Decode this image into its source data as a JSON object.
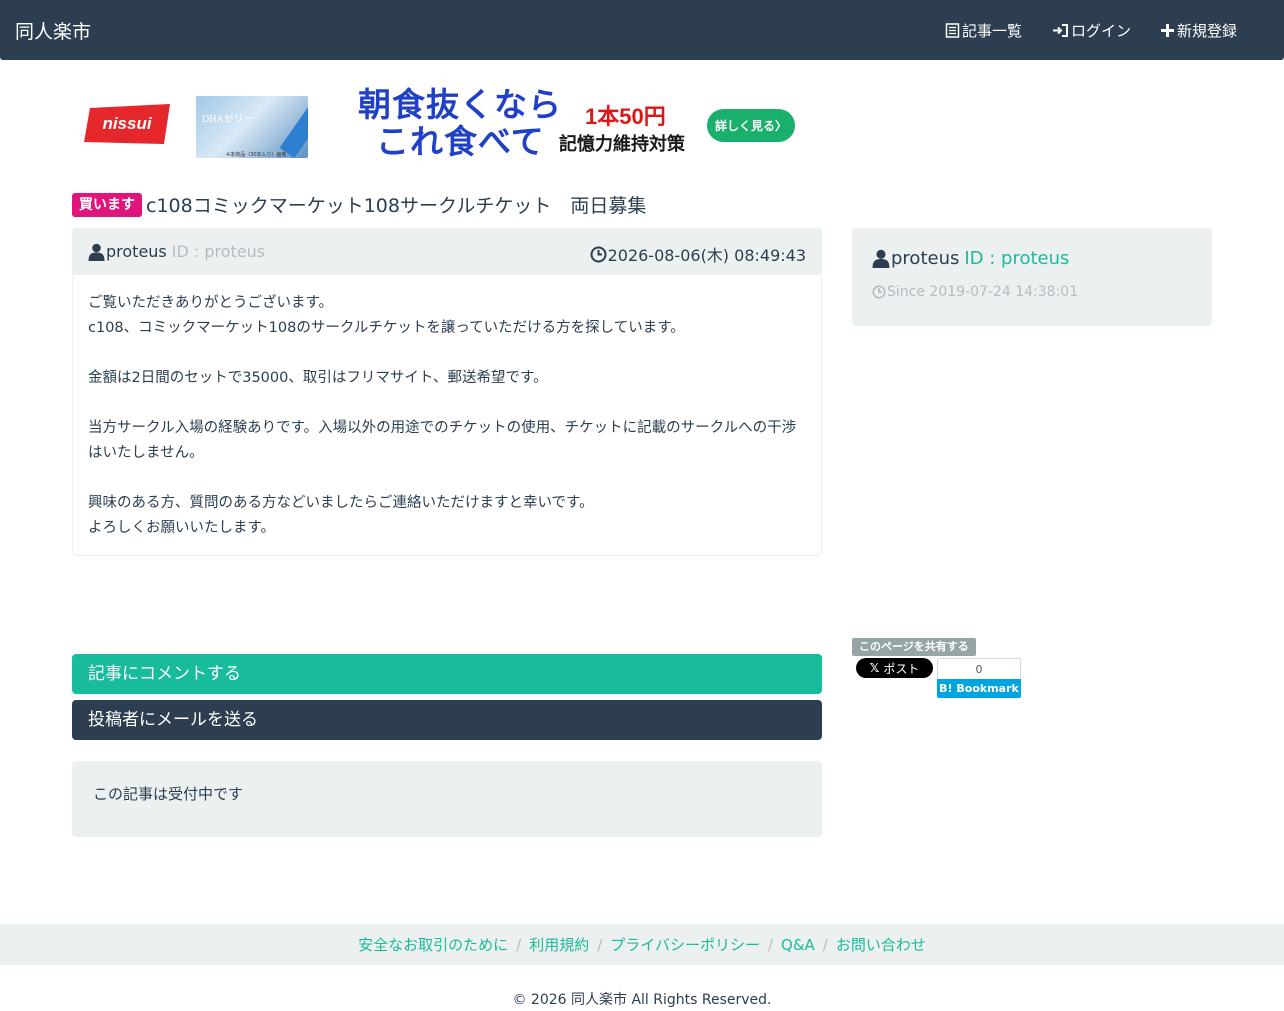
{
  "navbar": {
    "brand": "同人楽市",
    "items": [
      {
        "label": "記事一覧",
        "icon": "list-icon"
      },
      {
        "label": "ログイン",
        "icon": "login-icon"
      },
      {
        "label": "新規登録",
        "icon": "plus-icon"
      }
    ]
  },
  "ad": {
    "logo": "nissui",
    "product_label": "DHAゼリー",
    "product_note": "※本商品（30本入り）画像",
    "headline_line1": "朝食抜くなら",
    "headline_line2": "これ食べて",
    "price": "1本50円",
    "sub": "記憶力維持対策",
    "cta": "詳しく見る〉",
    "colors": {
      "logo_red": "#e5262a",
      "headline_blue": "#2140c8",
      "cta_green": "#18b06a"
    }
  },
  "post": {
    "badge": "買います",
    "title": "c108コミックマーケット108サークルチケット　両日募集",
    "author_name": "proteus",
    "author_id": "ID : proteus",
    "posted_at": "2026-08-06(木) 08:49:43",
    "body": [
      "ご覧いただきありがとうございます。",
      "c108、コミックマーケット108のサークルチケットを譲っていただける方を探しています。",
      "",
      "金額は2日間のセットで35000、取引はフリマサイト、郵送希望です。",
      "",
      "当方サークル入場の経験ありです。入場以外の用途でのチケットの使用、チケットに記載のサークルへの干渉はいたしません。",
      "",
      "興味のある方、質問のある方などいましたらご連絡いただけますと幸いです。",
      "よろしくお願いいたします。"
    ]
  },
  "profile": {
    "name": "proteus",
    "id": "ID : proteus",
    "since": "Since 2019-07-24 14:38:01"
  },
  "share": {
    "label": "このページを共有する",
    "x_label": "ポスト",
    "hatena_count": "0",
    "hatena_label": "Bookmark"
  },
  "actions": {
    "comment": "記事にコメントする",
    "mail": "投稿者にメールを送る",
    "status": "この記事は受付中です"
  },
  "footer": {
    "links": [
      "安全なお取引のために",
      "利用規約",
      "プライバシーポリシー",
      "Q&A",
      "お問い合わせ"
    ],
    "copyright": "© 2026 同人楽市 All Rights Reserved."
  },
  "colors": {
    "navbar": "#2c3e50",
    "accent": "#18bc9c",
    "badge": "#e0147a",
    "muted": "#b4bcc2",
    "well": "#ecf0f1"
  }
}
